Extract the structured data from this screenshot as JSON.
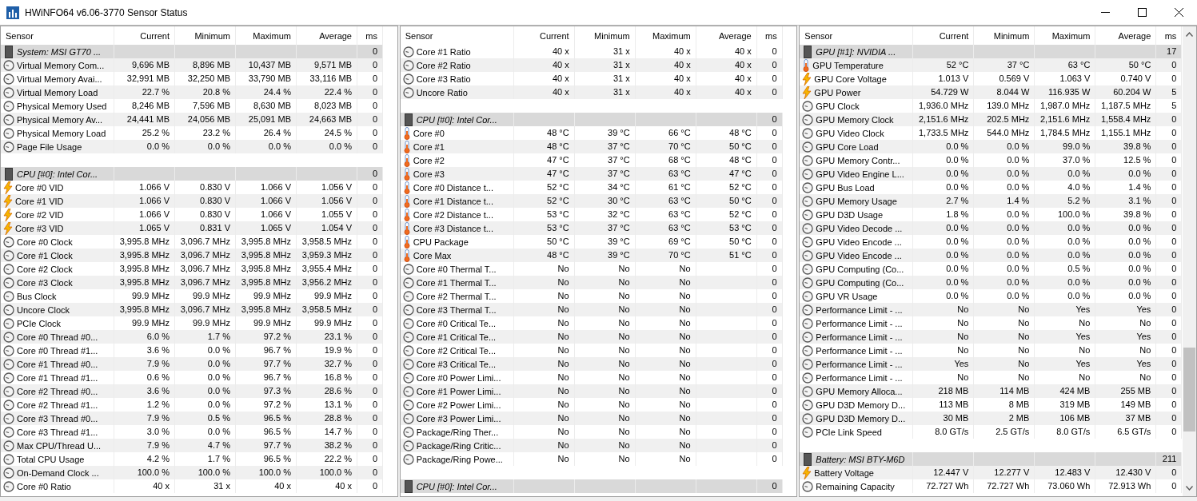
{
  "window": {
    "title": "HWiNFO64 v6.06-3770 Sensor Status"
  },
  "panels": [
    {
      "scrollbar": false,
      "columns": [
        "Sensor",
        "Current",
        "Minimum",
        "Maximum",
        "Average",
        "ms"
      ],
      "rows": [
        {
          "kind": "group",
          "sensor": "System: MSI GT70 ...",
          "ms": "0"
        },
        {
          "kind": "clock",
          "sensor": "Virtual Memory Com...",
          "current": "9,696 MB",
          "minimum": "8,896 MB",
          "maximum": "10,437 MB",
          "average": "9,571 MB",
          "ms": "0"
        },
        {
          "kind": "clock",
          "sensor": "Virtual Memory Avai...",
          "current": "32,991 MB",
          "minimum": "32,250 MB",
          "maximum": "33,790 MB",
          "average": "33,116 MB",
          "ms": "0"
        },
        {
          "kind": "clock",
          "sensor": "Virtual Memory Load",
          "current": "22.7 %",
          "minimum": "20.8 %",
          "maximum": "24.4 %",
          "average": "22.4 %",
          "ms": "0"
        },
        {
          "kind": "clock",
          "sensor": "Physical Memory Used",
          "current": "8,246 MB",
          "minimum": "7,596 MB",
          "maximum": "8,630 MB",
          "average": "8,023 MB",
          "ms": "0"
        },
        {
          "kind": "clock",
          "sensor": "Physical Memory Av...",
          "current": "24,441 MB",
          "minimum": "24,056 MB",
          "maximum": "25,091 MB",
          "average": "24,663 MB",
          "ms": "0"
        },
        {
          "kind": "clock",
          "sensor": "Physical Memory Load",
          "current": "25.2 %",
          "minimum": "23.2 %",
          "maximum": "26.4 %",
          "average": "24.5 %",
          "ms": "0"
        },
        {
          "kind": "clock",
          "sensor": "Page File Usage",
          "current": "0.0 %",
          "minimum": "0.0 %",
          "maximum": "0.0 %",
          "average": "0.0 %",
          "ms": "0"
        },
        {
          "kind": "blank"
        },
        {
          "kind": "group",
          "sensor": "CPU [#0]: Intel Cor...",
          "ms": "0"
        },
        {
          "kind": "volt",
          "sensor": "Core #0 VID",
          "current": "1.066 V",
          "minimum": "0.830 V",
          "maximum": "1.066 V",
          "average": "1.056 V",
          "ms": "0"
        },
        {
          "kind": "volt",
          "sensor": "Core #1 VID",
          "current": "1.066 V",
          "minimum": "0.830 V",
          "maximum": "1.066 V",
          "average": "1.056 V",
          "ms": "0"
        },
        {
          "kind": "volt",
          "sensor": "Core #2 VID",
          "current": "1.066 V",
          "minimum": "0.830 V",
          "maximum": "1.066 V",
          "average": "1.055 V",
          "ms": "0"
        },
        {
          "kind": "volt",
          "sensor": "Core #3 VID",
          "current": "1.065 V",
          "minimum": "0.831 V",
          "maximum": "1.065 V",
          "average": "1.054 V",
          "ms": "0"
        },
        {
          "kind": "clock",
          "sensor": "Core #0 Clock",
          "current": "3,995.8 MHz",
          "minimum": "3,096.7 MHz",
          "maximum": "3,995.8 MHz",
          "average": "3,958.5 MHz",
          "ms": "0"
        },
        {
          "kind": "clock",
          "sensor": "Core #1 Clock",
          "current": "3,995.8 MHz",
          "minimum": "3,096.7 MHz",
          "maximum": "3,995.8 MHz",
          "average": "3,959.3 MHz",
          "ms": "0"
        },
        {
          "kind": "clock",
          "sensor": "Core #2 Clock",
          "current": "3,995.8 MHz",
          "minimum": "3,096.7 MHz",
          "maximum": "3,995.8 MHz",
          "average": "3,955.4 MHz",
          "ms": "0"
        },
        {
          "kind": "clock",
          "sensor": "Core #3 Clock",
          "current": "3,995.8 MHz",
          "minimum": "3,096.7 MHz",
          "maximum": "3,995.8 MHz",
          "average": "3,956.2 MHz",
          "ms": "0"
        },
        {
          "kind": "clock",
          "sensor": "Bus Clock",
          "current": "99.9 MHz",
          "minimum": "99.9 MHz",
          "maximum": "99.9 MHz",
          "average": "99.9 MHz",
          "ms": "0"
        },
        {
          "kind": "clock",
          "sensor": "Uncore Clock",
          "current": "3,995.8 MHz",
          "minimum": "3,096.7 MHz",
          "maximum": "3,995.8 MHz",
          "average": "3,958.5 MHz",
          "ms": "0"
        },
        {
          "kind": "clock",
          "sensor": "PCIe Clock",
          "current": "99.9 MHz",
          "minimum": "99.9 MHz",
          "maximum": "99.9 MHz",
          "average": "99.9 MHz",
          "ms": "0"
        },
        {
          "kind": "clock",
          "sensor": "Core #0 Thread #0...",
          "current": "6.0 %",
          "minimum": "1.7 %",
          "maximum": "97.2 %",
          "average": "23.1 %",
          "ms": "0"
        },
        {
          "kind": "clock",
          "sensor": "Core #0 Thread #1...",
          "current": "3.6 %",
          "minimum": "0.0 %",
          "maximum": "96.7 %",
          "average": "19.9 %",
          "ms": "0"
        },
        {
          "kind": "clock",
          "sensor": "Core #1 Thread #0...",
          "current": "7.9 %",
          "minimum": "0.0 %",
          "maximum": "97.7 %",
          "average": "32.7 %",
          "ms": "0"
        },
        {
          "kind": "clock",
          "sensor": "Core #1 Thread #1...",
          "current": "0.6 %",
          "minimum": "0.0 %",
          "maximum": "96.7 %",
          "average": "16.8 %",
          "ms": "0"
        },
        {
          "kind": "clock",
          "sensor": "Core #2 Thread #0...",
          "current": "3.6 %",
          "minimum": "0.0 %",
          "maximum": "97.3 %",
          "average": "28.6 %",
          "ms": "0"
        },
        {
          "kind": "clock",
          "sensor": "Core #2 Thread #1...",
          "current": "1.2 %",
          "minimum": "0.0 %",
          "maximum": "97.2 %",
          "average": "13.1 %",
          "ms": "0"
        },
        {
          "kind": "clock",
          "sensor": "Core #3 Thread #0...",
          "current": "7.9 %",
          "minimum": "0.5 %",
          "maximum": "96.5 %",
          "average": "28.8 %",
          "ms": "0"
        },
        {
          "kind": "clock",
          "sensor": "Core #3 Thread #1...",
          "current": "3.0 %",
          "minimum": "0.0 %",
          "maximum": "96.5 %",
          "average": "14.7 %",
          "ms": "0"
        },
        {
          "kind": "clock",
          "sensor": "Max CPU/Thread U...",
          "current": "7.9 %",
          "minimum": "4.7 %",
          "maximum": "97.7 %",
          "average": "38.2 %",
          "ms": "0"
        },
        {
          "kind": "clock",
          "sensor": "Total CPU Usage",
          "current": "4.2 %",
          "minimum": "1.7 %",
          "maximum": "96.5 %",
          "average": "22.2 %",
          "ms": "0"
        },
        {
          "kind": "clock",
          "sensor": "On-Demand Clock ...",
          "current": "100.0 %",
          "minimum": "100.0 %",
          "maximum": "100.0 %",
          "average": "100.0 %",
          "ms": "0"
        },
        {
          "kind": "clock",
          "sensor": "Core #0 Ratio",
          "current": "40 x",
          "minimum": "31 x",
          "maximum": "40 x",
          "average": "40 x",
          "ms": "0"
        }
      ]
    },
    {
      "scrollbar": false,
      "columns": [
        "Sensor",
        "Current",
        "Minimum",
        "Maximum",
        "Average",
        "ms"
      ],
      "rows": [
        {
          "kind": "clock",
          "sensor": "Core #1 Ratio",
          "current": "40 x",
          "minimum": "31 x",
          "maximum": "40 x",
          "average": "40 x",
          "ms": "0"
        },
        {
          "kind": "clock",
          "sensor": "Core #2 Ratio",
          "current": "40 x",
          "minimum": "31 x",
          "maximum": "40 x",
          "average": "40 x",
          "ms": "0"
        },
        {
          "kind": "clock",
          "sensor": "Core #3 Ratio",
          "current": "40 x",
          "minimum": "31 x",
          "maximum": "40 x",
          "average": "40 x",
          "ms": "0"
        },
        {
          "kind": "clock",
          "sensor": "Uncore Ratio",
          "current": "40 x",
          "minimum": "31 x",
          "maximum": "40 x",
          "average": "40 x",
          "ms": "0"
        },
        {
          "kind": "blank"
        },
        {
          "kind": "group",
          "sensor": "CPU [#0]: Intel Cor...",
          "ms": "0"
        },
        {
          "kind": "temp",
          "sensor": "Core #0",
          "current": "48 °C",
          "minimum": "39 °C",
          "maximum": "66 °C",
          "average": "48 °C",
          "ms": "0"
        },
        {
          "kind": "temp",
          "sensor": "Core #1",
          "current": "48 °C",
          "minimum": "37 °C",
          "maximum": "70 °C",
          "average": "50 °C",
          "ms": "0"
        },
        {
          "kind": "temp",
          "sensor": "Core #2",
          "current": "47 °C",
          "minimum": "37 °C",
          "maximum": "68 °C",
          "average": "48 °C",
          "ms": "0"
        },
        {
          "kind": "temp",
          "sensor": "Core #3",
          "current": "47 °C",
          "minimum": "37 °C",
          "maximum": "63 °C",
          "average": "47 °C",
          "ms": "0"
        },
        {
          "kind": "temp",
          "sensor": "Core #0 Distance t...",
          "current": "52 °C",
          "minimum": "34 °C",
          "maximum": "61 °C",
          "average": "52 °C",
          "ms": "0"
        },
        {
          "kind": "temp",
          "sensor": "Core #1 Distance t...",
          "current": "52 °C",
          "minimum": "30 °C",
          "maximum": "63 °C",
          "average": "50 °C",
          "ms": "0"
        },
        {
          "kind": "temp",
          "sensor": "Core #2 Distance t...",
          "current": "53 °C",
          "minimum": "32 °C",
          "maximum": "63 °C",
          "average": "52 °C",
          "ms": "0"
        },
        {
          "kind": "temp",
          "sensor": "Core #3 Distance t...",
          "current": "53 °C",
          "minimum": "37 °C",
          "maximum": "63 °C",
          "average": "53 °C",
          "ms": "0"
        },
        {
          "kind": "temp",
          "sensor": "CPU Package",
          "current": "50 °C",
          "minimum": "39 °C",
          "maximum": "69 °C",
          "average": "50 °C",
          "ms": "0"
        },
        {
          "kind": "temp",
          "sensor": "Core Max",
          "current": "48 °C",
          "minimum": "39 °C",
          "maximum": "70 °C",
          "average": "51 °C",
          "ms": "0"
        },
        {
          "kind": "clock",
          "sensor": "Core #0 Thermal T...",
          "current": "No",
          "minimum": "No",
          "maximum": "No",
          "ms": "0"
        },
        {
          "kind": "clock",
          "sensor": "Core #1 Thermal T...",
          "current": "No",
          "minimum": "No",
          "maximum": "No",
          "ms": "0"
        },
        {
          "kind": "clock",
          "sensor": "Core #2 Thermal T...",
          "current": "No",
          "minimum": "No",
          "maximum": "No",
          "ms": "0"
        },
        {
          "kind": "clock",
          "sensor": "Core #3 Thermal T...",
          "current": "No",
          "minimum": "No",
          "maximum": "No",
          "ms": "0"
        },
        {
          "kind": "clock",
          "sensor": "Core #0 Critical Te...",
          "current": "No",
          "minimum": "No",
          "maximum": "No",
          "ms": "0"
        },
        {
          "kind": "clock",
          "sensor": "Core #1 Critical Te...",
          "current": "No",
          "minimum": "No",
          "maximum": "No",
          "ms": "0"
        },
        {
          "kind": "clock",
          "sensor": "Core #2 Critical Te...",
          "current": "No",
          "minimum": "No",
          "maximum": "No",
          "ms": "0"
        },
        {
          "kind": "clock",
          "sensor": "Core #3 Critical Te...",
          "current": "No",
          "minimum": "No",
          "maximum": "No",
          "ms": "0"
        },
        {
          "kind": "clock",
          "sensor": "Core #0 Power Limi...",
          "current": "No",
          "minimum": "No",
          "maximum": "No",
          "ms": "0"
        },
        {
          "kind": "clock",
          "sensor": "Core #1 Power Limi...",
          "current": "No",
          "minimum": "No",
          "maximum": "No",
          "ms": "0"
        },
        {
          "kind": "clock",
          "sensor": "Core #2 Power Limi...",
          "current": "No",
          "minimum": "No",
          "maximum": "No",
          "ms": "0"
        },
        {
          "kind": "clock",
          "sensor": "Core #3 Power Limi...",
          "current": "No",
          "minimum": "No",
          "maximum": "No",
          "ms": "0"
        },
        {
          "kind": "clock",
          "sensor": "Package/Ring Ther...",
          "current": "No",
          "minimum": "No",
          "maximum": "No",
          "ms": "0"
        },
        {
          "kind": "clock",
          "sensor": "Package/Ring Critic...",
          "current": "No",
          "minimum": "No",
          "maximum": "No",
          "ms": "0"
        },
        {
          "kind": "clock",
          "sensor": "Package/Ring Powe...",
          "current": "No",
          "minimum": "No",
          "maximum": "No",
          "ms": "0"
        },
        {
          "kind": "blank"
        },
        {
          "kind": "group",
          "sensor": "CPU [#0]: Intel Cor...",
          "ms": "0"
        }
      ]
    },
    {
      "scrollbar": true,
      "columns": [
        "Sensor",
        "Current",
        "Minimum",
        "Maximum",
        "Average",
        "ms"
      ],
      "rows": [
        {
          "kind": "group",
          "sensor": "GPU [#1]: NVIDIA ...",
          "ms": "17"
        },
        {
          "kind": "temp",
          "sensor": "GPU Temperature",
          "current": "52 °C",
          "minimum": "37 °C",
          "maximum": "63 °C",
          "average": "50 °C",
          "ms": "0"
        },
        {
          "kind": "volt",
          "sensor": "GPU Core Voltage",
          "current": "1.013 V",
          "minimum": "0.569 V",
          "maximum": "1.063 V",
          "average": "0.740 V",
          "ms": "0"
        },
        {
          "kind": "volt",
          "sensor": "GPU Power",
          "current": "54.729 W",
          "minimum": "8.044 W",
          "maximum": "116.935 W",
          "average": "60.204 W",
          "ms": "5"
        },
        {
          "kind": "clock",
          "sensor": "GPU Clock",
          "current": "1,936.0 MHz",
          "minimum": "139.0 MHz",
          "maximum": "1,987.0 MHz",
          "average": "1,187.5 MHz",
          "ms": "5"
        },
        {
          "kind": "clock",
          "sensor": "GPU Memory Clock",
          "current": "2,151.6 MHz",
          "minimum": "202.5 MHz",
          "maximum": "2,151.6 MHz",
          "average": "1,558.4 MHz",
          "ms": "0"
        },
        {
          "kind": "clock",
          "sensor": "GPU Video Clock",
          "current": "1,733.5 MHz",
          "minimum": "544.0 MHz",
          "maximum": "1,784.5 MHz",
          "average": "1,155.1 MHz",
          "ms": "0"
        },
        {
          "kind": "clock",
          "sensor": "GPU Core Load",
          "current": "0.0 %",
          "minimum": "0.0 %",
          "maximum": "99.0 %",
          "average": "39.8 %",
          "ms": "0"
        },
        {
          "kind": "clock",
          "sensor": "GPU Memory Contr...",
          "current": "0.0 %",
          "minimum": "0.0 %",
          "maximum": "37.0 %",
          "average": "12.5 %",
          "ms": "0"
        },
        {
          "kind": "clock",
          "sensor": "GPU Video Engine L...",
          "current": "0.0 %",
          "minimum": "0.0 %",
          "maximum": "0.0 %",
          "average": "0.0 %",
          "ms": "0"
        },
        {
          "kind": "clock",
          "sensor": "GPU Bus Load",
          "current": "0.0 %",
          "minimum": "0.0 %",
          "maximum": "4.0 %",
          "average": "1.4 %",
          "ms": "0"
        },
        {
          "kind": "clock",
          "sensor": "GPU Memory Usage",
          "current": "2.7 %",
          "minimum": "1.4 %",
          "maximum": "5.2 %",
          "average": "3.1 %",
          "ms": "0"
        },
        {
          "kind": "clock",
          "sensor": "GPU D3D Usage",
          "current": "1.8 %",
          "minimum": "0.0 %",
          "maximum": "100.0 %",
          "average": "39.8 %",
          "ms": "0"
        },
        {
          "kind": "clock",
          "sensor": "GPU Video Decode ...",
          "current": "0.0 %",
          "minimum": "0.0 %",
          "maximum": "0.0 %",
          "average": "0.0 %",
          "ms": "0"
        },
        {
          "kind": "clock",
          "sensor": "GPU Video Encode ...",
          "current": "0.0 %",
          "minimum": "0.0 %",
          "maximum": "0.0 %",
          "average": "0.0 %",
          "ms": "0"
        },
        {
          "kind": "clock",
          "sensor": "GPU Video Encode ...",
          "current": "0.0 %",
          "minimum": "0.0 %",
          "maximum": "0.0 %",
          "average": "0.0 %",
          "ms": "0"
        },
        {
          "kind": "clock",
          "sensor": "GPU Computing (Co...",
          "current": "0.0 %",
          "minimum": "0.0 %",
          "maximum": "0.5 %",
          "average": "0.0 %",
          "ms": "0"
        },
        {
          "kind": "clock",
          "sensor": "GPU Computing (Co...",
          "current": "0.0 %",
          "minimum": "0.0 %",
          "maximum": "0.0 %",
          "average": "0.0 %",
          "ms": "0"
        },
        {
          "kind": "clock",
          "sensor": "GPU VR Usage",
          "current": "0.0 %",
          "minimum": "0.0 %",
          "maximum": "0.0 %",
          "average": "0.0 %",
          "ms": "0"
        },
        {
          "kind": "clock",
          "sensor": "Performance Limit - ...",
          "current": "No",
          "minimum": "No",
          "maximum": "Yes",
          "average": "Yes",
          "ms": "0"
        },
        {
          "kind": "clock",
          "sensor": "Performance Limit - ...",
          "current": "No",
          "minimum": "No",
          "maximum": "No",
          "average": "No",
          "ms": "0"
        },
        {
          "kind": "clock",
          "sensor": "Performance Limit - ...",
          "current": "No",
          "minimum": "No",
          "maximum": "Yes",
          "average": "Yes",
          "ms": "0"
        },
        {
          "kind": "clock",
          "sensor": "Performance Limit - ...",
          "current": "No",
          "minimum": "No",
          "maximum": "No",
          "average": "No",
          "ms": "0"
        },
        {
          "kind": "clock",
          "sensor": "Performance Limit - ...",
          "current": "Yes",
          "minimum": "No",
          "maximum": "Yes",
          "average": "Yes",
          "ms": "0"
        },
        {
          "kind": "clock",
          "sensor": "Performance Limit - ...",
          "current": "No",
          "minimum": "No",
          "maximum": "No",
          "average": "No",
          "ms": "0"
        },
        {
          "kind": "clock",
          "sensor": "GPU Memory Alloca...",
          "current": "218 MB",
          "minimum": "114 MB",
          "maximum": "424 MB",
          "average": "255 MB",
          "ms": "0"
        },
        {
          "kind": "clock",
          "sensor": "GPU D3D Memory D...",
          "current": "113 MB",
          "minimum": "8 MB",
          "maximum": "319 MB",
          "average": "149 MB",
          "ms": "0"
        },
        {
          "kind": "clock",
          "sensor": "GPU D3D Memory D...",
          "current": "30 MB",
          "minimum": "2 MB",
          "maximum": "106 MB",
          "average": "37 MB",
          "ms": "0"
        },
        {
          "kind": "clock",
          "sensor": "PCIe Link Speed",
          "current": "8.0 GT/s",
          "minimum": "2.5 GT/s",
          "maximum": "8.0 GT/s",
          "average": "6.5 GT/s",
          "ms": "0"
        },
        {
          "kind": "blank"
        },
        {
          "kind": "group",
          "sensor": "Battery: MSI BTY-M6D",
          "ms": "211"
        },
        {
          "kind": "volt",
          "sensor": "Battery Voltage",
          "current": "12.447 V",
          "minimum": "12.277 V",
          "maximum": "12.483 V",
          "average": "12.430 V",
          "ms": "0"
        },
        {
          "kind": "clock",
          "sensor": "Remaining Capacity",
          "current": "72.727 Wh",
          "minimum": "72.727 Wh",
          "maximum": "73.060 Wh",
          "average": "72.913 Wh",
          "ms": "0"
        }
      ]
    }
  ]
}
